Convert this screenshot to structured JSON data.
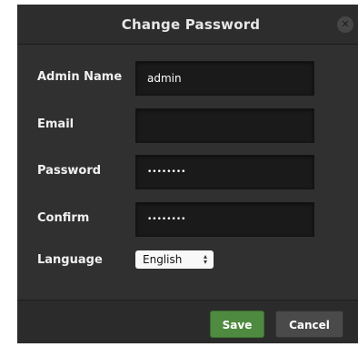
{
  "dialog": {
    "title": "Change Password",
    "close_icon": "close-icon"
  },
  "form": {
    "admin_name_label": "Admin Name",
    "admin_name_value": "admin",
    "email_label": "Email",
    "email_value": "",
    "password_label": "Password",
    "password_value": "••••••••",
    "confirm_label": "Confirm",
    "confirm_value": "••••••••",
    "language_label": "Language",
    "language_selected": "English"
  },
  "footer": {
    "save_label": "Save",
    "cancel_label": "Cancel"
  },
  "colors": {
    "dialog_bg": "#303030",
    "save_button": "#4e8a3f",
    "cancel_button": "#4a4a4a"
  }
}
